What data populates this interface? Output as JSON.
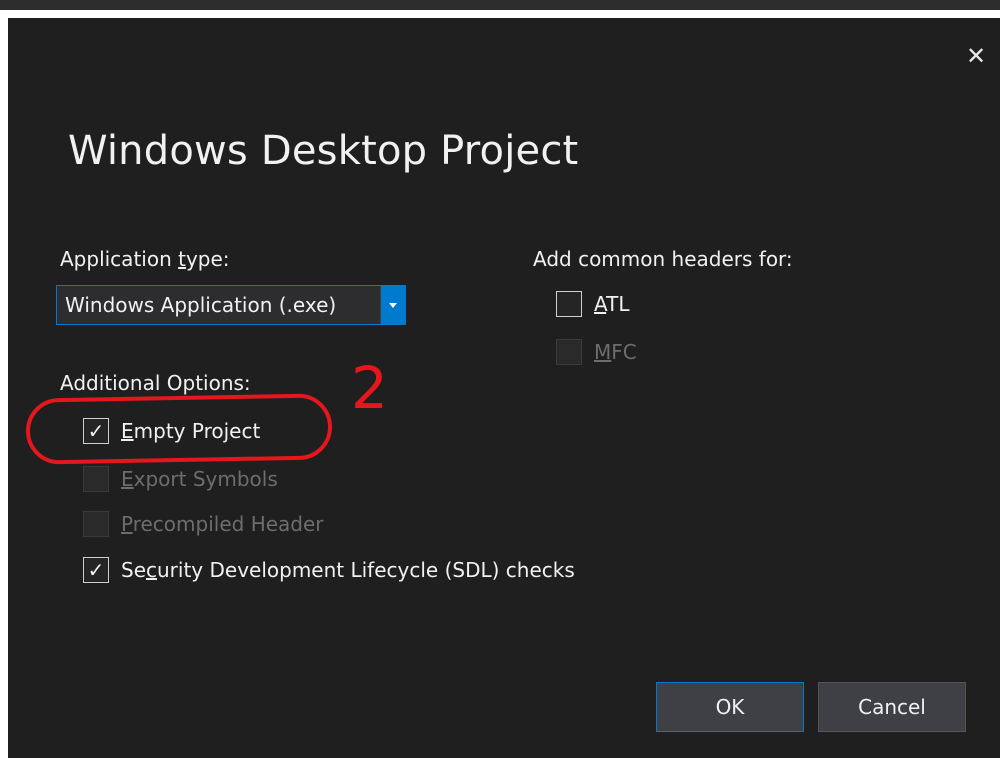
{
  "dialog": {
    "title": "Windows Desktop Project",
    "close_glyph": "✕"
  },
  "app_type": {
    "label_before": "Application ",
    "label_accel": "t",
    "label_after": "ype:",
    "selected": "Windows Application (.exe)"
  },
  "headers": {
    "label": "Add common headers for:",
    "atl": {
      "accel": "A",
      "rest": "TL",
      "checked": false,
      "enabled": true
    },
    "mfc": {
      "accel": "M",
      "rest": "FC",
      "checked": false,
      "enabled": false
    }
  },
  "options": {
    "label": "Additional Options:",
    "empty_project": {
      "accel": "E",
      "rest": "mpty Project",
      "checked": true,
      "enabled": true
    },
    "export_symbols": {
      "accel": "E",
      "rest": "xport Symbols",
      "checked": false,
      "enabled": false
    },
    "precompiled_header": {
      "accel": "P",
      "rest": "recompiled Header",
      "checked": false,
      "enabled": false
    },
    "sdl_checks": {
      "before": "Se",
      "accel": "c",
      "after": "urity Development Lifecycle (SDL) checks",
      "checked": true,
      "enabled": true
    }
  },
  "annotation": {
    "number": "2",
    "color": "#e5171c"
  },
  "buttons": {
    "ok": "OK",
    "cancel": "Cancel"
  },
  "check_glyph": "✓",
  "colors": {
    "accent": "#007acc",
    "background": "#1f1f1f"
  }
}
